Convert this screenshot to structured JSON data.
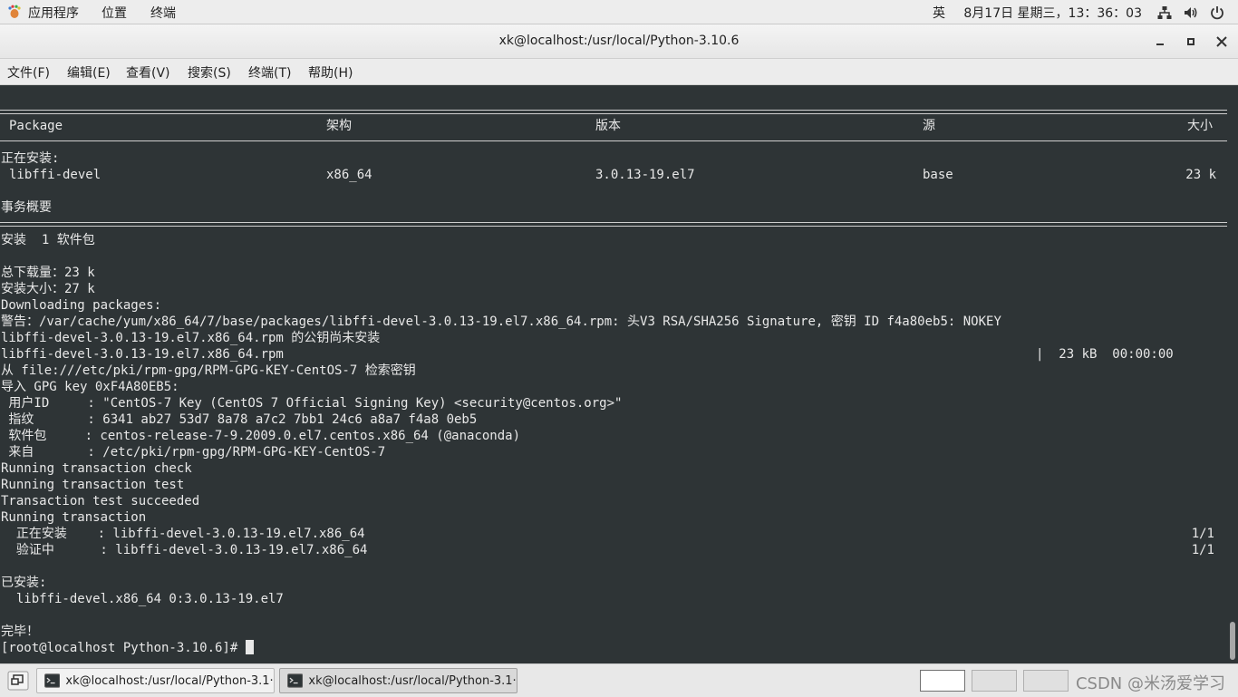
{
  "top_panel": {
    "apps_menu": "应用程序",
    "places_menu": "位置",
    "terminal_menu": "终端",
    "input_method": "英",
    "clock": "8月17日 星期三，13：36：03"
  },
  "window": {
    "title": "xk@localhost:/usr/local/Python-3.10.6"
  },
  "menubar": {
    "file": "文件(F)",
    "edit": "编辑(E)",
    "view": "查看(V)",
    "search": "搜索(S)",
    "terminal": "终端(T)",
    "help": "帮助(H)"
  },
  "terminal": {
    "table_header": {
      "package": "Package",
      "arch": "架构",
      "version": "版本",
      "repo": "源",
      "size": "大小"
    },
    "installing_label": "正在安装:",
    "package_row": {
      "name": "libffi-devel",
      "arch": "x86_64",
      "version": "3.0.13-19.el7",
      "repo": "base",
      "size": "23 k"
    },
    "summary_label": "事务概要",
    "lines": [
      "安装  1 软件包",
      "",
      "总下载量：23 k",
      "安装大小：27 k",
      "Downloading packages:",
      "警告：/var/cache/yum/x86_64/7/base/packages/libffi-devel-3.0.13-19.el7.x86_64.rpm: 头V3 RSA/SHA256 Signature, 密钥 ID f4a80eb5: NOKEY",
      "libffi-devel-3.0.13-19.el7.x86_64.rpm 的公钥尚未安装",
      "libffi-devel-3.0.13-19.el7.x86_64.rpm",
      "从 file:///etc/pki/rpm-gpg/RPM-GPG-KEY-CentOS-7 检索密钥",
      "导入 GPG key 0xF4A80EB5:",
      " 用户ID     : \"CentOS-7 Key (CentOS 7 Official Signing Key) <security@centos.org>\"",
      " 指纹       : 6341 ab27 53d7 8a78 a7c2 7bb1 24c6 a8a7 f4a8 0eb5",
      " 软件包     : centos-release-7-9.2009.0.el7.centos.x86_64 (@anaconda)",
      " 来自       : /etc/pki/rpm-gpg/RPM-GPG-KEY-CentOS-7",
      "Running transaction check",
      "Running transaction test",
      "Transaction test succeeded",
      "Running transaction",
      "  正在安装    : libffi-devel-3.0.13-19.el7.x86_64",
      "  验证中      : libffi-devel-3.0.13-19.el7.x86_64",
      "",
      "已安装:",
      "  libffi-devel.x86_64 0:3.0.13-19.el7",
      "",
      "完毕！"
    ],
    "download_stats": "|  23 kB  00:00:00",
    "progress_1": "1/1",
    "progress_2": "1/1",
    "prompt": "[root@localhost Python-3.10.6]# "
  },
  "taskbar": {
    "task1": "xk@localhost:/usr/local/Python-3.1···",
    "task2": "xk@localhost:/usr/local/Python-3.1···",
    "watermark": "CSDN @米汤爱学习"
  },
  "colors": {
    "terminal_bg": "#2e3436",
    "terminal_fg": "#e8e8e8",
    "panel_bg": "#ededed"
  },
  "icons": {
    "apps": "gnome-foot-icon",
    "network": "network-icon",
    "volume": "volume-icon",
    "power": "power-icon",
    "show_desktop": "show-desktop-icon",
    "terminal_app": "terminal-icon"
  }
}
